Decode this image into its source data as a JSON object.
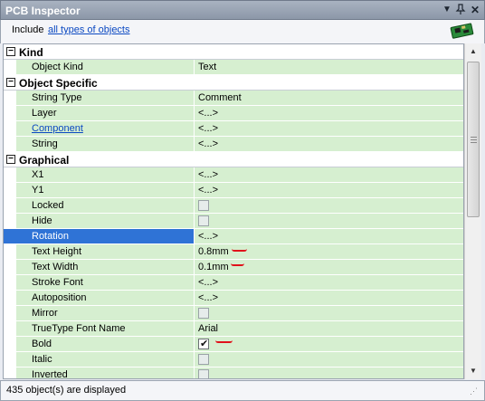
{
  "window": {
    "title": "PCB Inspector"
  },
  "filter": {
    "include_label": "Include",
    "link_text": "all types of objects"
  },
  "grid": {
    "categories": [
      {
        "label": "Kind",
        "toggle": "−"
      },
      {
        "label": "Object Specific",
        "toggle": "−"
      },
      {
        "label": "Graphical",
        "toggle": "−"
      }
    ],
    "rows": {
      "object_kind": {
        "name": "Object Kind",
        "value": "Text"
      },
      "string_type": {
        "name": "String Type",
        "value": "Comment"
      },
      "layer": {
        "name": "Layer",
        "value": "<...>"
      },
      "component": {
        "name": "Component",
        "value": "<...>"
      },
      "string": {
        "name": "String",
        "value": "<...>"
      },
      "x1": {
        "name": "X1",
        "value": "<...>"
      },
      "y1": {
        "name": "Y1",
        "value": "<...>"
      },
      "locked": {
        "name": "Locked",
        "checked": false
      },
      "hide": {
        "name": "Hide",
        "checked": false
      },
      "rotation": {
        "name": "Rotation",
        "value": "<...>"
      },
      "text_height": {
        "name": "Text Height",
        "value": "0.8mm"
      },
      "text_width": {
        "name": "Text Width",
        "value": "0.1mm"
      },
      "stroke_font": {
        "name": "Stroke Font",
        "value": "<...>"
      },
      "autoposition": {
        "name": "Autoposition",
        "value": "<...>"
      },
      "mirror": {
        "name": "Mirror",
        "checked": false
      },
      "truetype_font_name": {
        "name": "TrueType Font Name",
        "value": "Arial"
      },
      "bold": {
        "name": "Bold",
        "checked": true
      },
      "italic": {
        "name": "Italic",
        "checked": false
      },
      "inverted": {
        "name": "Inverted",
        "checked": false
      }
    }
  },
  "status": {
    "text": "435 object(s) are displayed"
  },
  "colors": {
    "row_green": "#d6efd0",
    "selection": "#2f73d6",
    "annotation": "#e0121b",
    "link": "#0b49c2"
  }
}
